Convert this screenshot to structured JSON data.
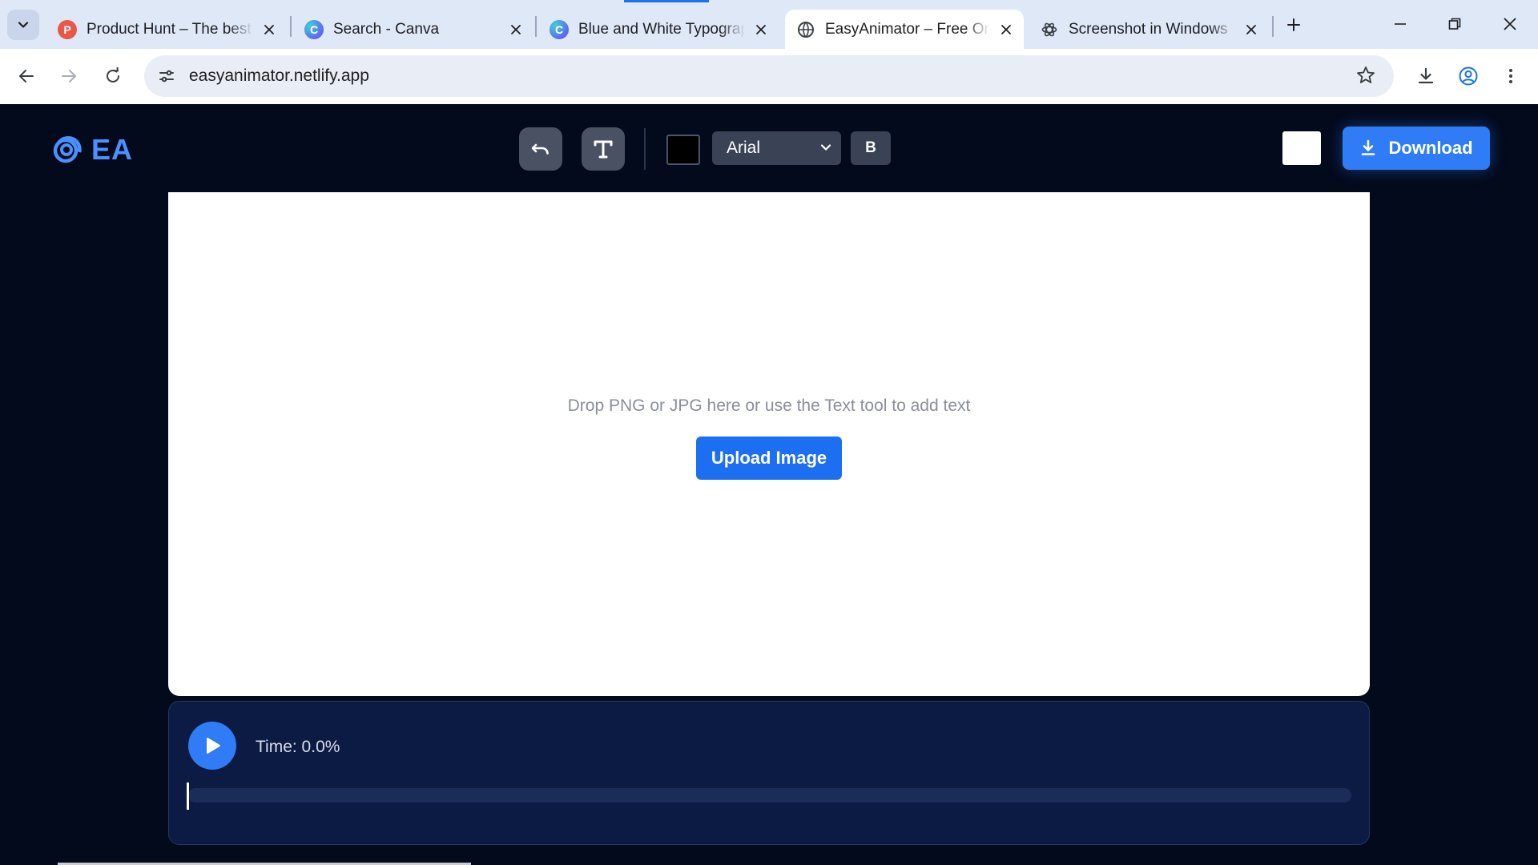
{
  "browser": {
    "tabs": [
      {
        "title": "Product Hunt – The best new products",
        "favicon": "product-hunt-icon",
        "active": false
      },
      {
        "title": "Search - Canva",
        "favicon": "canva-icon",
        "active": false
      },
      {
        "title": "Blue and White Typography",
        "favicon": "canva-icon",
        "active": false
      },
      {
        "title": "EasyAnimator – Free Online",
        "favicon": "globe-icon",
        "active": true
      },
      {
        "title": "Screenshot in Windows",
        "favicon": "openai-icon",
        "active": false
      }
    ],
    "address": {
      "url": "easyanimator.netlify.app"
    },
    "colors": {
      "tabstrip": "#dfe8f7",
      "omnibox": "#e9eef6",
      "accent": "#1a73e8"
    }
  },
  "app": {
    "logo_text": "EA",
    "toolbar": {
      "text_color": "#000000",
      "font": "Arial",
      "bold_label": "B",
      "background_color": "#ffffff",
      "download_label": "Download"
    },
    "canvas": {
      "hint": "Drop PNG or JPG here or use the Text tool to add text",
      "upload_label": "Upload Image"
    },
    "timeline": {
      "time_label": "Time: 0.0%",
      "progress": 0.0
    },
    "colors": {
      "background": "#030a1c",
      "primary": "#2f7cf6",
      "panel": "#0b1b44"
    }
  }
}
